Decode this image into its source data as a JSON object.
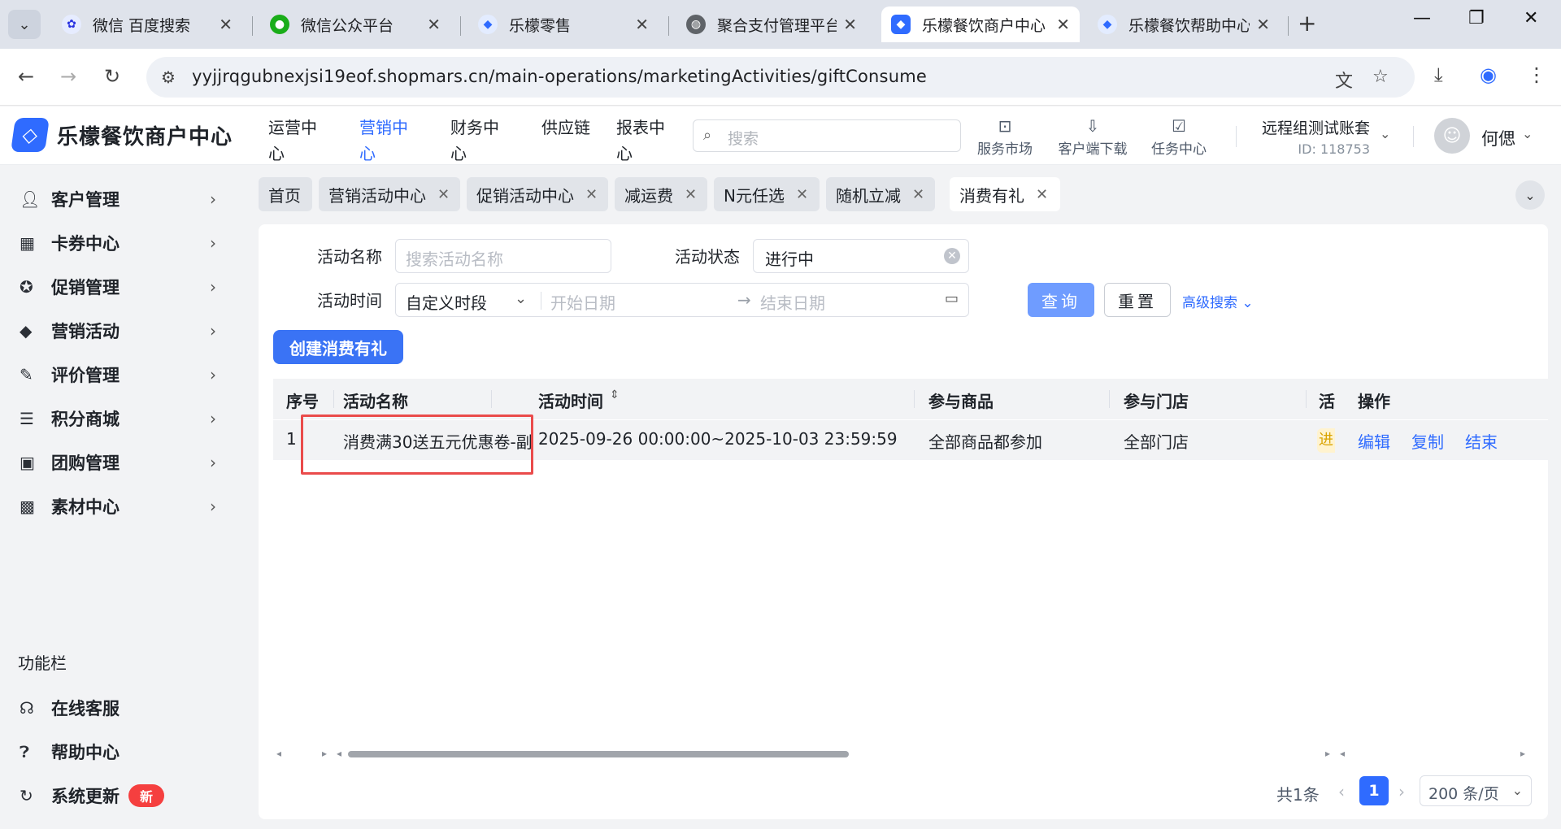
{
  "browser": {
    "tabs": [
      {
        "title": "微信 百度搜索",
        "icon": "baidu-icon"
      },
      {
        "title": "微信公众平台",
        "icon": "wechat-icon"
      },
      {
        "title": "乐檬零售",
        "icon": "lemeng-icon"
      },
      {
        "title": "聚合支付管理平台",
        "icon": "globe-icon"
      },
      {
        "title": "乐檬餐饮商户中心",
        "icon": "lemeng-icon"
      },
      {
        "title": "乐檬餐饮帮助中心",
        "icon": "lemeng-icon"
      }
    ],
    "active_tab_index": 4,
    "url": "yyjjrqgubnexjsi19eof.shopmars.cn/main-operations/marketingActivities/giftConsume"
  },
  "header": {
    "logo_text": "乐檬餐饮商户中心",
    "nav": [
      "运营中心",
      "营销中心",
      "财务中心",
      "供应链",
      "报表中心"
    ],
    "active_nav_index": 1,
    "search_placeholder": "搜索",
    "tools": [
      "服务市场",
      "客户端下载",
      "任务中心"
    ],
    "account_name": "远程组测试账套",
    "account_id": "ID: 118753",
    "user_name": "何偲"
  },
  "sidebar": {
    "items": [
      {
        "label": "客户管理",
        "icon": "user-icon"
      },
      {
        "label": "卡券中心",
        "icon": "ticket-icon"
      },
      {
        "label": "促销管理",
        "icon": "promo-icon"
      },
      {
        "label": "营销活动",
        "icon": "tag-icon"
      },
      {
        "label": "评价管理",
        "icon": "edit-icon"
      },
      {
        "label": "积分商城",
        "icon": "coins-icon"
      },
      {
        "label": "团购管理",
        "icon": "group-buy-icon"
      },
      {
        "label": "素材中心",
        "icon": "image-icon"
      }
    ],
    "section_title": "功能栏",
    "tools": [
      {
        "label": "在线客服",
        "icon": "headset-icon"
      },
      {
        "label": "帮助中心",
        "icon": "help-icon"
      },
      {
        "label": "系统更新",
        "icon": "refresh-icon",
        "badge": "新"
      }
    ]
  },
  "page_tabs": {
    "items": [
      "首页",
      "营销活动中心",
      "促销活动中心",
      "减运费",
      "N元任选",
      "随机立减",
      "消费有礼"
    ],
    "active_index": 6
  },
  "filters": {
    "name_label": "活动名称",
    "name_placeholder": "搜索活动名称",
    "status_label": "活动状态",
    "status_value": "进行中",
    "time_label": "活动时间",
    "time_type": "自定义时段",
    "start_placeholder": "开始日期",
    "end_placeholder": "结束日期",
    "range_sep": "→",
    "query_button": "查询",
    "reset_button": "重置",
    "advanced_link": "高级搜索"
  },
  "create_button": "创建消费有礼",
  "table": {
    "headers": [
      "序号",
      "活动名称",
      "活动时间",
      "参与商品",
      "参与门店",
      "活",
      "操作"
    ],
    "rows": [
      {
        "index": "1",
        "name": "消费满30送五元优惠卷-副",
        "time": "2025-09-26 00:00:00~2025-10-03 23:59:59",
        "goods": "全部商品都参加",
        "stores": "全部门店",
        "status": "进",
        "actions": [
          "编辑",
          "复制",
          "结束"
        ]
      }
    ]
  },
  "pagination": {
    "total": "共1条",
    "current_page": "1",
    "page_size": "200 条/页"
  },
  "colors": {
    "primary": "#2f6bff",
    "highlight": "#ea4b4b"
  }
}
